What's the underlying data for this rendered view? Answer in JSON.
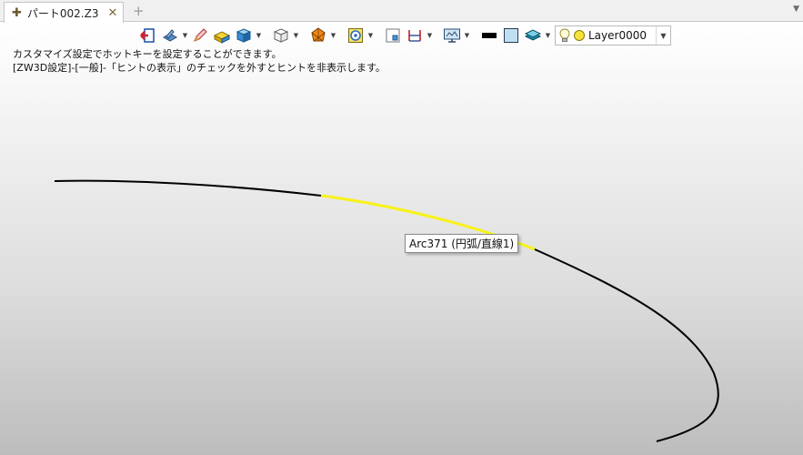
{
  "tab": {
    "title": "パート002.Z3"
  },
  "layer": {
    "name": "Layer0000"
  },
  "hint": {
    "line1": "カスタマイズ設定でホットキーを設定することができます。",
    "line2": "[ZW3D設定]-[一般]-「ヒントの表示」のチェックを外すとヒントを非表示します。"
  },
  "tooltip": {
    "text": "Arc371 (円弧/直線1)"
  },
  "colors": {
    "highlight": "#f7f21a",
    "curve": "#000000"
  },
  "icons": [
    "exit-icon",
    "sketch-icon",
    "pencil-icon",
    "shapes-icon",
    "cube-icon",
    "wireframe-cube-icon",
    "filter-icon",
    "target-icon",
    "snap-icon",
    "dimension-icon",
    "display-icon",
    "line-color-icon",
    "face-color-icon",
    "layer-icon",
    "bulb-icon"
  ]
}
